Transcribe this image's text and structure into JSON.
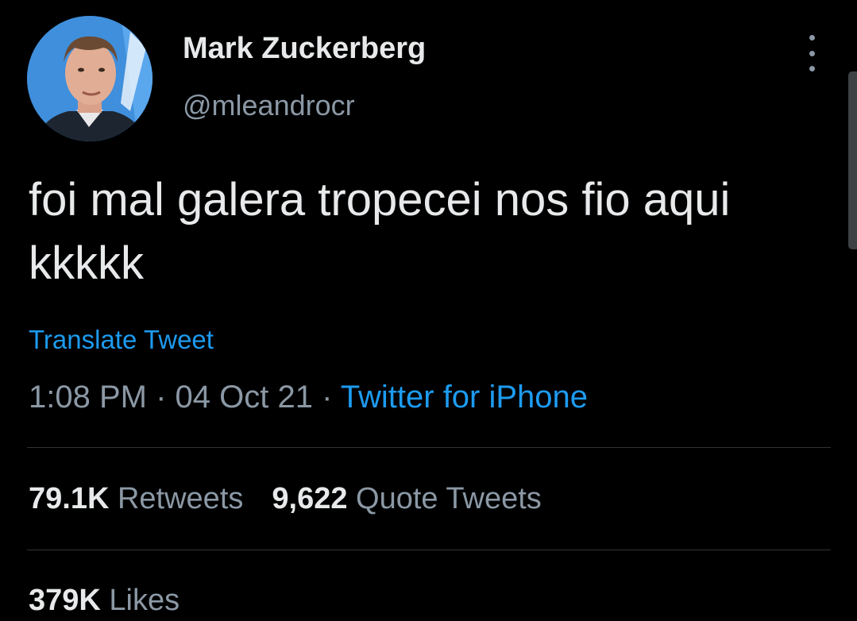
{
  "tweet": {
    "author": {
      "display_name": "Mark Zuckerberg",
      "handle": "@mleandrocr"
    },
    "text": "foi mal galera tropecei nos fio aqui\nkkkkk",
    "translate_label": "Translate Tweet",
    "time": "1:08 PM",
    "separator": " · ",
    "date": "04 Oct 21",
    "source": "Twitter for iPhone"
  },
  "stats": {
    "retweets": {
      "count": "79.1K",
      "label": "Retweets"
    },
    "quote_tweets": {
      "count": "9,622",
      "label": "Quote Tweets"
    },
    "likes": {
      "count": "379K",
      "label": "Likes"
    }
  },
  "icons": {
    "more": "more-options-icon"
  },
  "colors": {
    "background": "#000000",
    "text_primary": "#e7e9ea",
    "text_secondary": "#8b98a5",
    "accent": "#1d9bf0",
    "divider": "#2f3336"
  }
}
